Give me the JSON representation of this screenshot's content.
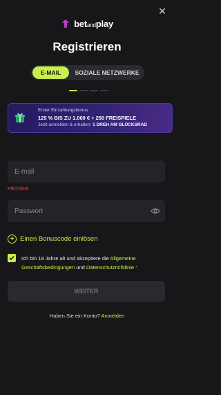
{
  "header": {
    "brand_bet": "bet",
    "brand_and": "and",
    "brand_play": "play",
    "close_icon": "close-icon"
  },
  "title": "Registrieren",
  "tabs": [
    {
      "label": "E-MAIL",
      "active": true
    },
    {
      "label": "SOZIALE NETZWERKE",
      "active": false
    }
  ],
  "banner": {
    "line1": "Erster Einzahlungsbonus",
    "line2": "125 % BIS ZU 1.000 € + 250 FREISPIELE",
    "line3_prefix": "Jetzt anmelden & erhalten:",
    "line3_bold": "1 DREH AM GLÜCKSRAD",
    "icon": "gift-icon"
  },
  "form": {
    "email_placeholder": "E-mail",
    "email_error": "Pflichtfeld",
    "password_placeholder": "Passwort",
    "password_icon": "eye-icon",
    "bonus_label": "Einen Bonuscode einlösen",
    "terms_prefix": "Ich bin 18 Jahre alt und akzeptiere die",
    "terms_link1": "Allgemeine Geschäftsbedingungen",
    "terms_and": "und",
    "terms_link2": "Datenschutzrichtlinie",
    "terms_required": "*",
    "submit_label": "WEITER"
  },
  "footer": {
    "question": "Haben Sie ein Konto?",
    "login_link": "Anmelden"
  },
  "colors": {
    "accent": "#c8f04a",
    "background": "#17171a",
    "error": "#e84545"
  }
}
